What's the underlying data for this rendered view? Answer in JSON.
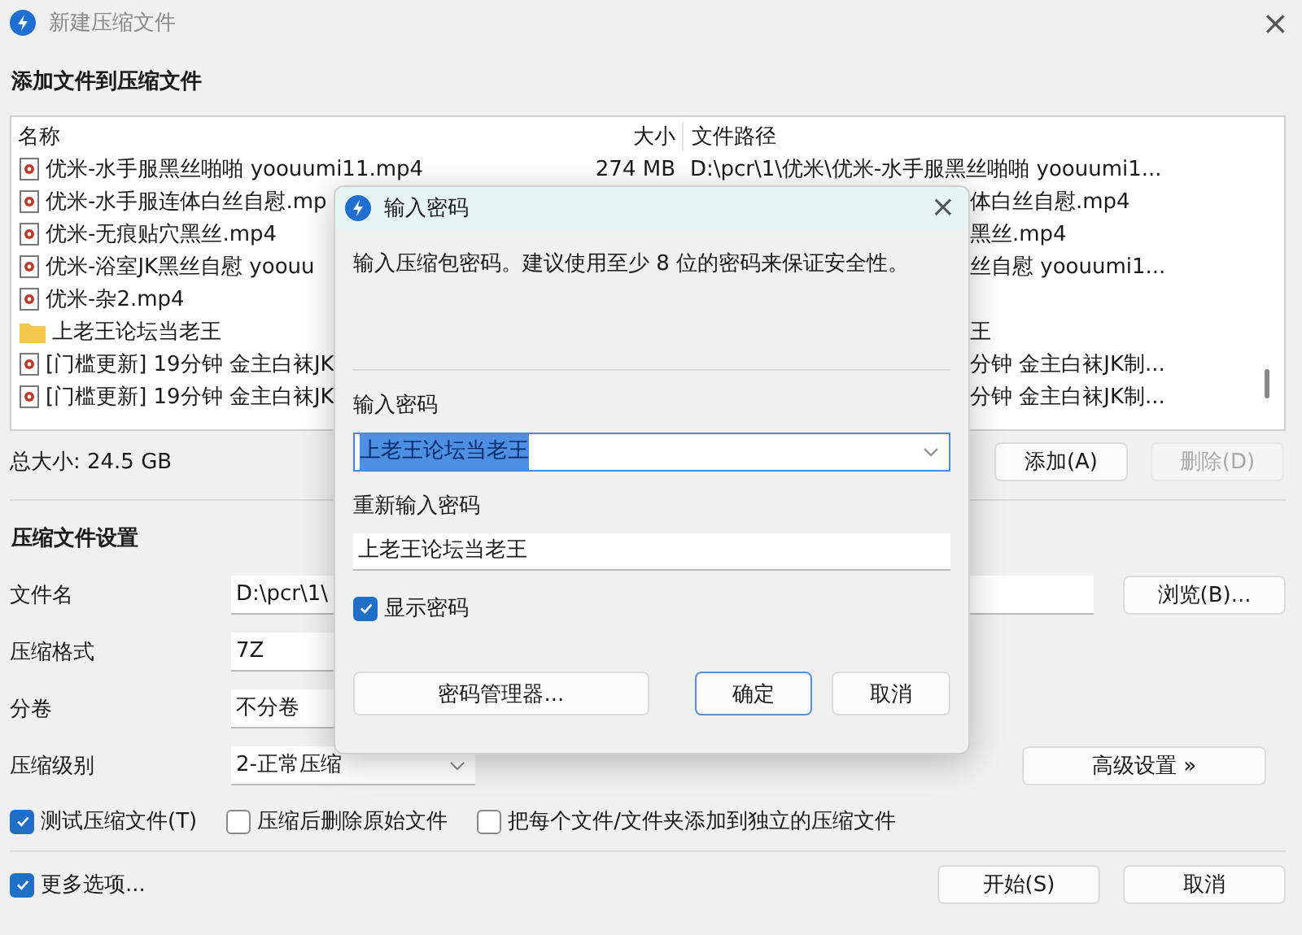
{
  "window": {
    "title": "新建压缩文件",
    "close": "×"
  },
  "section_title": "添加文件到压缩文件",
  "file_list": {
    "columns": [
      "名称",
      "大小",
      "文件路径"
    ],
    "rows": [
      {
        "kind": "file",
        "name": "优米-水手服黑丝啪啪 yoouumi11.mp4",
        "size": "274 MB",
        "path": "D:\\pcr\\1\\优米\\优米-水手服黑丝啪啪 yoouumi1...",
        "covered": false
      },
      {
        "kind": "file",
        "name": "优米-水手服连体白丝自慰.mp",
        "path": "体白丝自慰.mp4",
        "covered": true
      },
      {
        "kind": "file",
        "name": "优米-无痕贴穴黑丝.mp4",
        "path": "黑丝.mp4",
        "covered": true
      },
      {
        "kind": "file",
        "name": "优米-浴室JK黑丝自慰 yoouu",
        "path": "丝自慰 yoouumi1...",
        "covered": true
      },
      {
        "kind": "file",
        "name": "优米-杂2.mp4"
      },
      {
        "kind": "folder",
        "name": "上老王论坛当老王",
        "path": "王",
        "covered": true
      },
      {
        "kind": "file",
        "name": "[门槛更新] 19分钟 金主白袜JK",
        "path": "分钟 金主白袜JK制...",
        "covered": true
      },
      {
        "kind": "file",
        "name": "[门槛更新] 19分钟 金主白袜JK",
        "path": "分钟 金主白袜JK制...",
        "covered": true
      }
    ]
  },
  "total_size": "总大小: 24.5 GB",
  "list_buttons": [
    {
      "label": "添加(A)",
      "disabled": false
    },
    {
      "label": "删除(D)",
      "disabled": true
    }
  ],
  "settings": {
    "title": "压缩文件设置",
    "filename": {
      "label": "文件名",
      "value": "D:\\pcr\\1\\"
    },
    "browse_button": "浏览(B)...",
    "format": {
      "label": "压缩格式",
      "value": "7Z"
    },
    "split": {
      "label": "分卷",
      "value": "不分卷"
    },
    "level": {
      "label": "压缩级别",
      "value": "2-正常压缩"
    },
    "advanced_button": "高级设置 »"
  },
  "options": [
    {
      "label": "测试压缩文件(T)",
      "checked": true
    },
    {
      "label": "压缩后删除原始文件",
      "checked": false
    },
    {
      "label": "把每个文件/文件夹添加到独立的压缩文件",
      "checked": false
    }
  ],
  "more_options": {
    "label": "更多选项...",
    "checked": true
  },
  "footer_buttons": [
    {
      "label": "开始(S)"
    },
    {
      "label": "取消"
    }
  ],
  "dialog": {
    "title": "输入密码",
    "close": "×",
    "description": "输入压缩包密码。建议使用至少 8 位的密码来保证安全性。",
    "password_label": "输入密码",
    "password_value": "上老王论坛当老王",
    "password_selected": true,
    "repeat_label": "重新输入密码",
    "repeat_value": "上老王论坛当老王",
    "show_password": {
      "label": "显示密码",
      "checked": true
    },
    "manager_button": "密码管理器...",
    "buttons": [
      {
        "label": "确定",
        "default": true
      },
      {
        "label": "取消",
        "default": false
      }
    ]
  }
}
